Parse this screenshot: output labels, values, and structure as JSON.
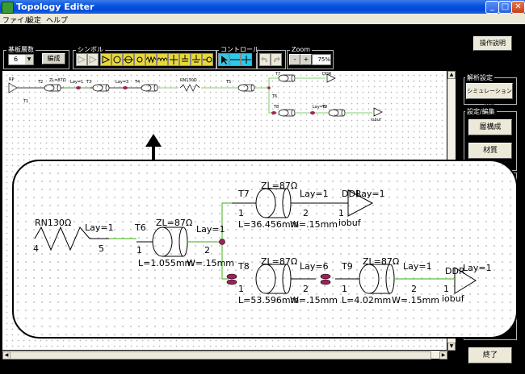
{
  "window": {
    "title": "Topology Editer"
  },
  "menu": [
    "ファイル",
    "設定",
    "ヘルプ"
  ],
  "toolbar": {
    "layers_label": "基板層数",
    "layers_value": "6",
    "edit_button": "編成",
    "symbols_label": "シンボル",
    "control_label": "コントロール",
    "zoom_label": "Zoom",
    "zoom_minus": "-",
    "zoom_plus": "+",
    "zoom_value": "75%"
  },
  "right_panel": {
    "manual_button": "操作説明",
    "analysis_label": "解析設定",
    "simulation_button": "シミュレーション設定",
    "edit_label": "設定/編集",
    "layer_button": "層構成",
    "material_button": "材質",
    "exit_button": "終了"
  },
  "schematic_small": {
    "labels": [
      "T1",
      "T2",
      "T3",
      "T4",
      "T5",
      "T6",
      "T7",
      "T8",
      "T9",
      "RN130Ω",
      "ZL=87Ω",
      "Lay=1",
      "Lay=6",
      "Lay=3",
      "DDR",
      "iobuf"
    ]
  },
  "zoom_view": {
    "rn_label": "RN130Ω",
    "rn_lay": "Lay=1",
    "rn_pin_left": "4",
    "rn_pin_right": "5",
    "t6": {
      "name": "T6",
      "zl": "ZL=87Ω",
      "lay": "Lay=1",
      "pin1": "1",
      "pin2": "2",
      "length": "L=1.055mm",
      "width": "W=.15mm"
    },
    "t7": {
      "name": "T7",
      "zl": "ZL=87Ω",
      "lay": "Lay=1",
      "pin1": "1",
      "pin2": "2",
      "length": "L=36.456mm",
      "width": "W=.15mm"
    },
    "t8": {
      "name": "T8",
      "zl": "ZL=87Ω",
      "lay": "Lay=6",
      "pin1": "1",
      "pin2": "2",
      "length": "L=53.596mm",
      "width": "W=.15mm"
    },
    "t9": {
      "name": "T9",
      "zl": "ZL=87Ω",
      "lay": "Lay=1",
      "pin1": "1",
      "pin2": "2",
      "length": "L=4.02mm",
      "width": "W=.15mm"
    },
    "ddr_top": {
      "name": "DDR",
      "lay": "Lay=1",
      "pin": "1",
      "type": "iobuf"
    },
    "ddr_bottom": {
      "name": "DDR",
      "lay": "Lay=1",
      "pin": "1",
      "type": "iobuf"
    }
  },
  "colors": {
    "wire": "#5cbf3a",
    "via": "#a0205a",
    "canvas_bg": "#ffffff",
    "titlebar": "#0a54e0"
  }
}
